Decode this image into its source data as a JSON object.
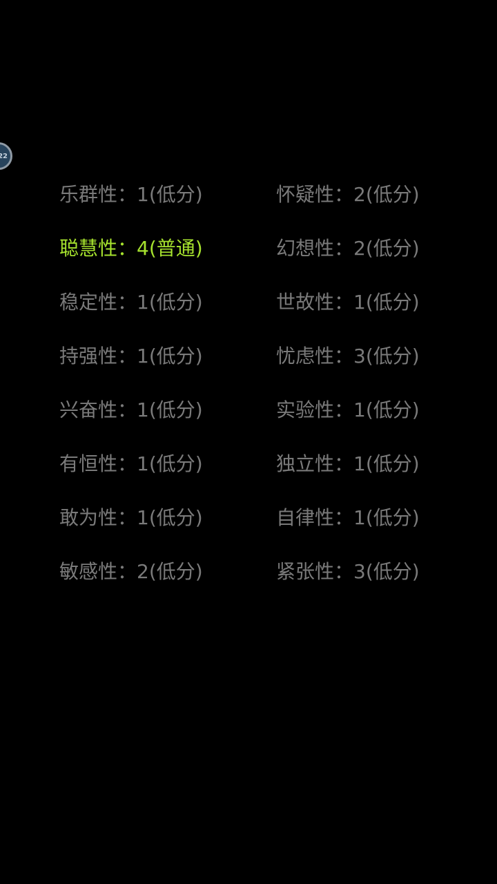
{
  "bubble": {
    "text": "22"
  },
  "rows": [
    {
      "left": {
        "text": "乐群性：1(低分)",
        "highlight": false
      },
      "right": {
        "text": "怀疑性：2(低分)",
        "highlight": false
      }
    },
    {
      "left": {
        "text": "聪慧性：4(普通)",
        "highlight": true
      },
      "right": {
        "text": "幻想性：2(低分)",
        "highlight": false
      }
    },
    {
      "left": {
        "text": "稳定性：1(低分)",
        "highlight": false
      },
      "right": {
        "text": "世故性：1(低分)",
        "highlight": false
      }
    },
    {
      "left": {
        "text": "持强性：1(低分)",
        "highlight": false
      },
      "right": {
        "text": "忧虑性：3(低分)",
        "highlight": false
      }
    },
    {
      "left": {
        "text": "兴奋性：1(低分)",
        "highlight": false
      },
      "right": {
        "text": "实验性：1(低分)",
        "highlight": false
      }
    },
    {
      "left": {
        "text": "有恒性：1(低分)",
        "highlight": false
      },
      "right": {
        "text": "独立性：1(低分)",
        "highlight": false
      }
    },
    {
      "left": {
        "text": "敢为性：1(低分)",
        "highlight": false
      },
      "right": {
        "text": "自律性：1(低分)",
        "highlight": false
      }
    },
    {
      "left": {
        "text": "敏感性：2(低分)",
        "highlight": false
      },
      "right": {
        "text": "紧张性：3(低分)",
        "highlight": false
      }
    }
  ],
  "colors": {
    "background": "#000000",
    "normal_text": "#7a7a7a",
    "highlight_text": "#a6e22e"
  }
}
